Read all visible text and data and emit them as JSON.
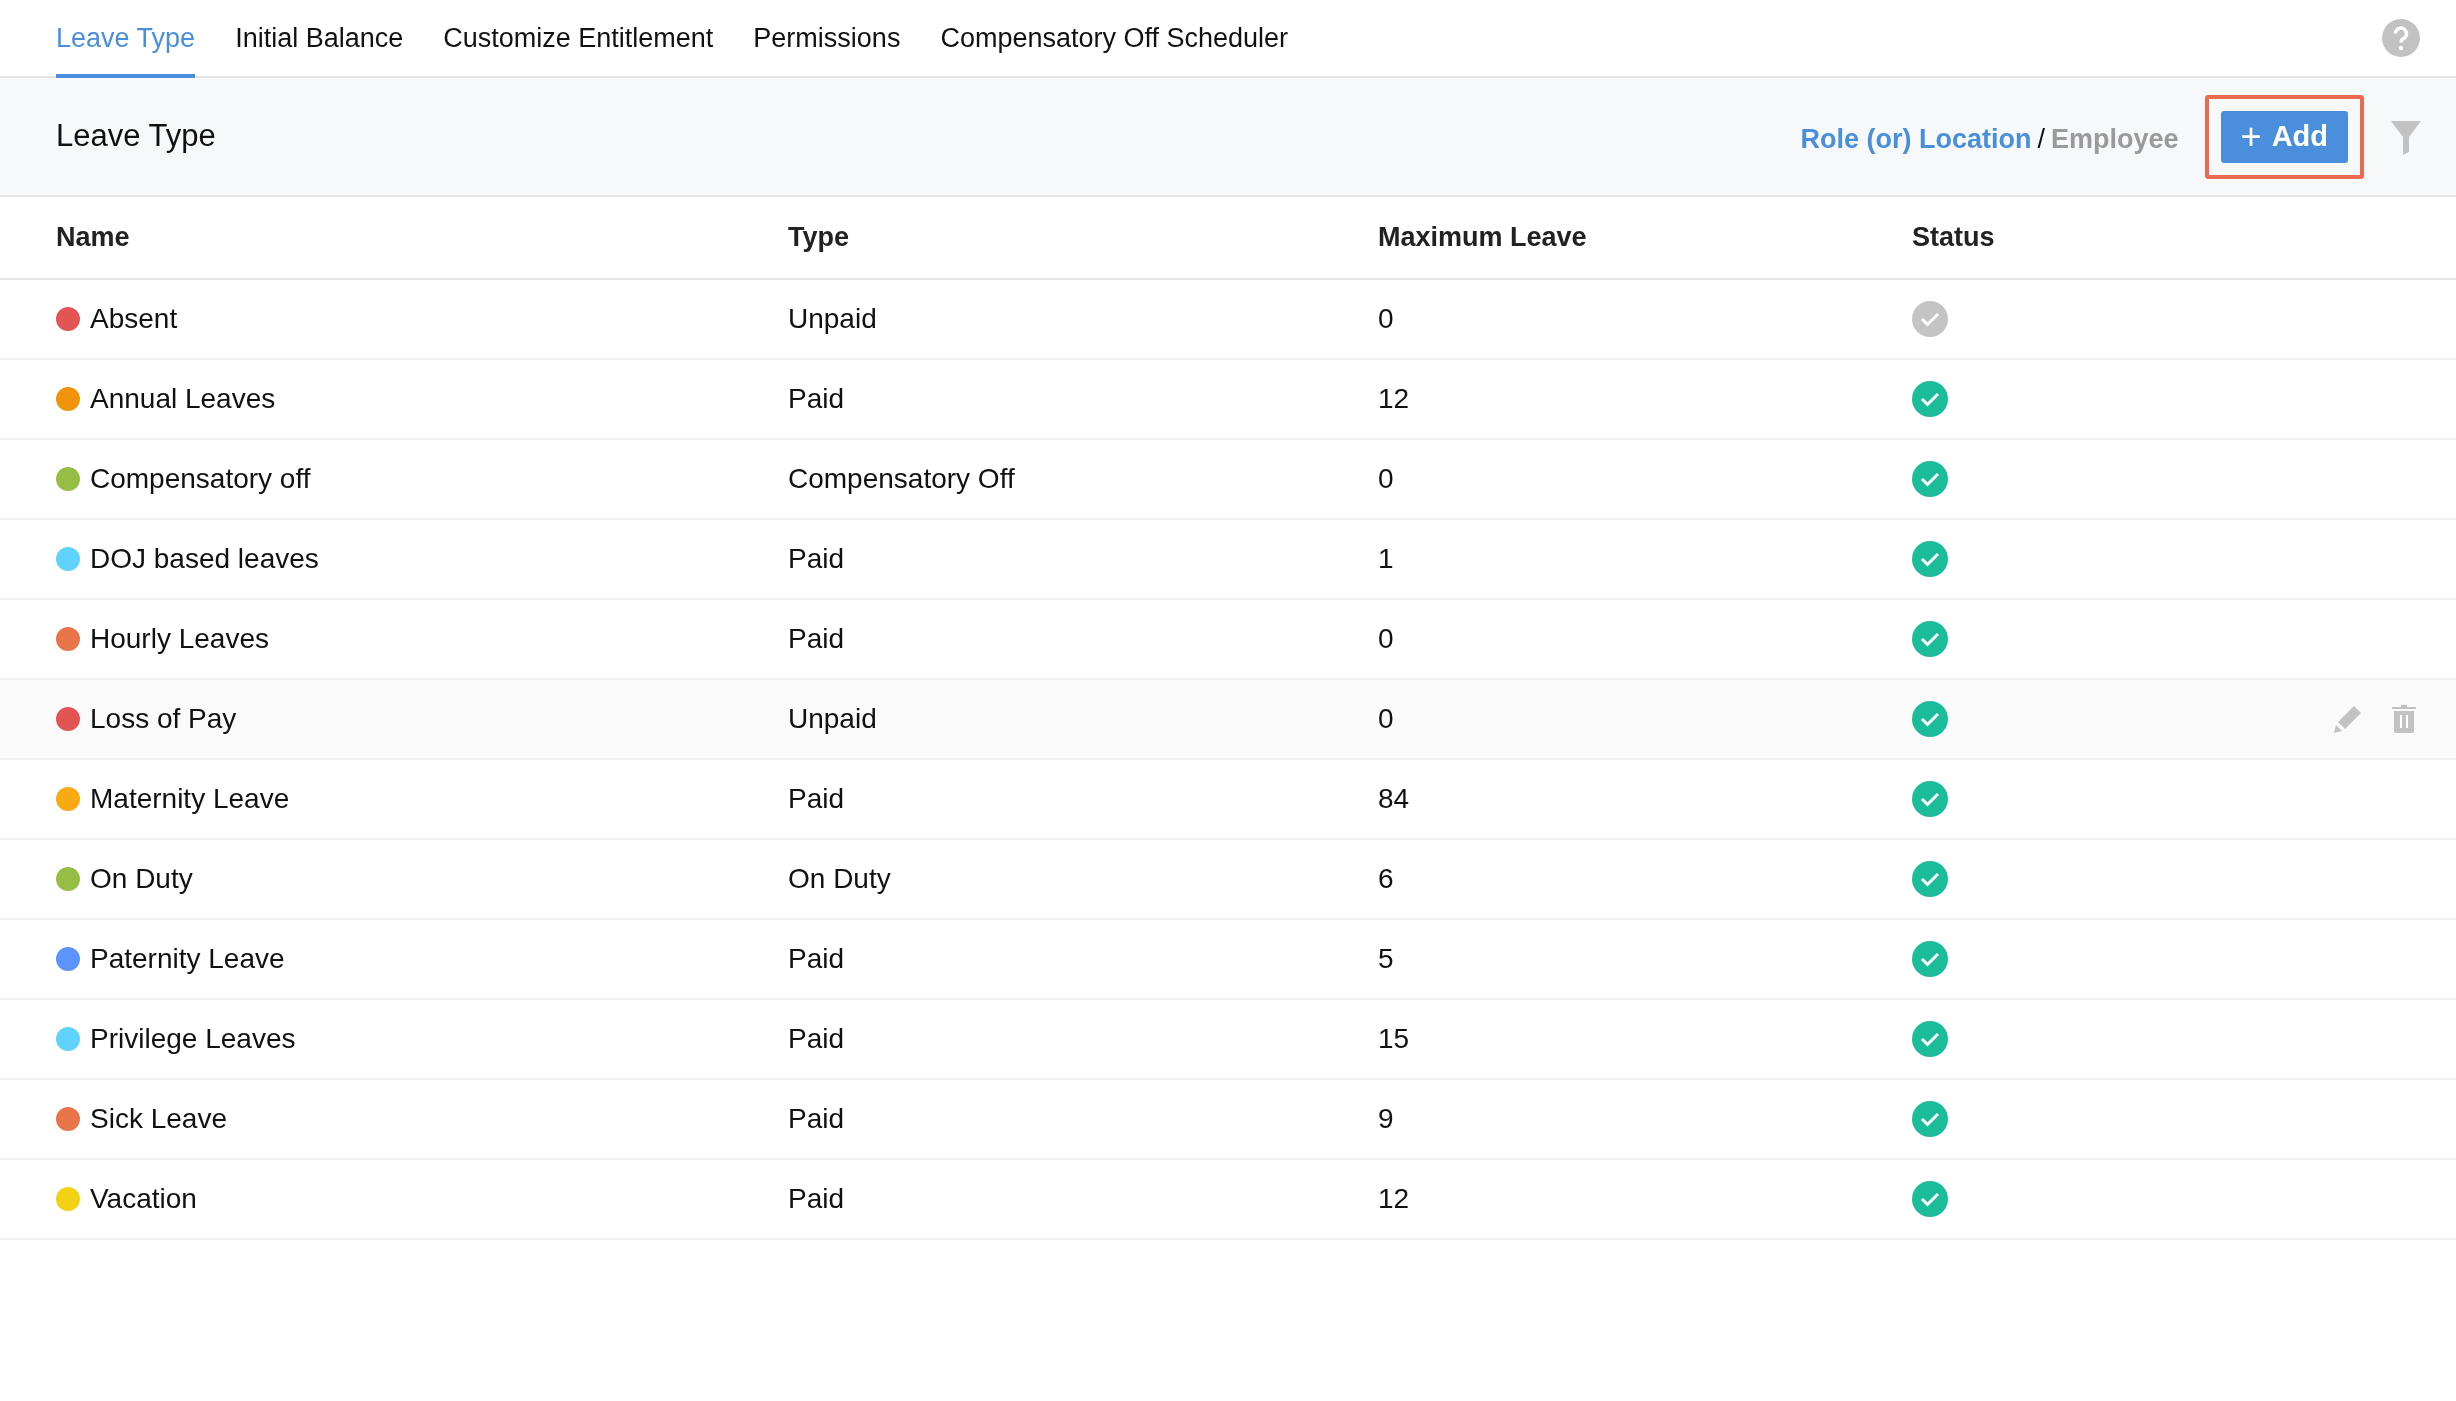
{
  "tabs": [
    {
      "label": "Leave Type",
      "selected": true
    },
    {
      "label": "Initial Balance",
      "selected": false
    },
    {
      "label": "Customize Entitlement",
      "selected": false
    },
    {
      "label": "Permissions",
      "selected": false
    },
    {
      "label": "Compensatory Off Scheduler",
      "selected": false
    }
  ],
  "header": {
    "title": "Leave Type",
    "scope_link": "Role (or) Location",
    "separator": "/",
    "scope_other": "Employee",
    "add_button": {
      "icon": "+",
      "label": "Add",
      "outlined": true
    }
  },
  "table": {
    "columns": [
      "Name",
      "Type",
      "Maximum Leave",
      "Status"
    ],
    "rows": [
      {
        "name": "Absent",
        "color": "#e25555",
        "type": "Unpaid",
        "maximum": "0",
        "active": false,
        "hovered": false
      },
      {
        "name": "Annual Leaves",
        "color": "#f0940c",
        "type": "Paid",
        "maximum": "12",
        "active": true,
        "hovered": false
      },
      {
        "name": "Compensatory off",
        "color": "#96be45",
        "type": "Compensatory Off",
        "maximum": "0",
        "active": true,
        "hovered": false
      },
      {
        "name": "DOJ based leaves",
        "color": "#5fd3fb",
        "type": "Paid",
        "maximum": "1",
        "active": true,
        "hovered": false
      },
      {
        "name": "Hourly Leaves",
        "color": "#e8744a",
        "type": "Paid",
        "maximum": "0",
        "active": true,
        "hovered": false
      },
      {
        "name": "Loss of Pay",
        "color": "#e25555",
        "type": "Unpaid",
        "maximum": "0",
        "active": true,
        "hovered": true
      },
      {
        "name": "Maternity Leave",
        "color": "#f8aa13",
        "type": "Paid",
        "maximum": "84",
        "active": true,
        "hovered": false
      },
      {
        "name": "On Duty",
        "color": "#96be45",
        "type": "On Duty",
        "maximum": "6",
        "active": true,
        "hovered": false
      },
      {
        "name": "Paternity Leave",
        "color": "#5b95fb",
        "type": "Paid",
        "maximum": "5",
        "active": true,
        "hovered": false
      },
      {
        "name": "Privilege Leaves",
        "color": "#5fd3fb",
        "type": "Paid",
        "maximum": "15",
        "active": true,
        "hovered": false
      },
      {
        "name": "Sick Leave",
        "color": "#e8744a",
        "type": "Paid",
        "maximum": "9",
        "active": true,
        "hovered": false
      },
      {
        "name": "Vacation",
        "color": "#f1d313",
        "type": "Paid",
        "maximum": "12",
        "active": true,
        "hovered": false
      }
    ]
  }
}
